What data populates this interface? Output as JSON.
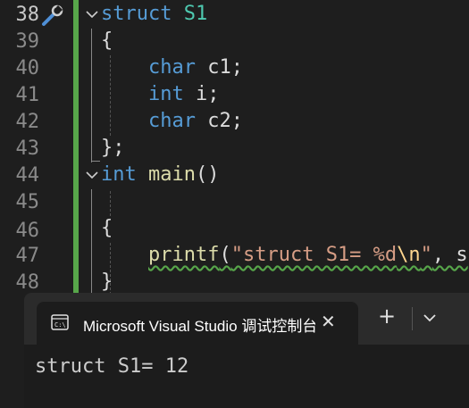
{
  "editor": {
    "line_numbers": [
      "38",
      "39",
      "40",
      "41",
      "42",
      "43",
      "44",
      "45",
      "46",
      "47",
      "48"
    ],
    "lines": {
      "l38_kw": "struct",
      "l38_name": "S1",
      "l39": "{",
      "l40_type": "char",
      "l40_rest": " c1;",
      "l41_type": "int",
      "l41_rest": " i;",
      "l42_type": "char",
      "l42_rest": " c2;",
      "l43": "};",
      "l44_type": "int",
      "l44_fn": "main",
      "l44_rest": "()",
      "l46": "{",
      "l47_fn": "printf",
      "l47_open": "(",
      "l47_str1": "\"struct S1= %d",
      "l47_esc": "\\n",
      "l47_str2": "\"",
      "l47_rest": ", s",
      "l48": "}"
    }
  },
  "console": {
    "tab_title": "Microsoft Visual Studio 调试控制台",
    "close_glyph": "✕",
    "new_tab_glyph": "+",
    "output_text": "struct S1= 12"
  },
  "icons": {
    "wrench": "wrench-icon",
    "terminal": "terminal-icon",
    "chevron": "chevron-down-icon"
  },
  "colors": {
    "keyword": "#569cd6",
    "function": "#dcdcaa",
    "string": "#d69d85",
    "change_bar": "#57a64a"
  }
}
